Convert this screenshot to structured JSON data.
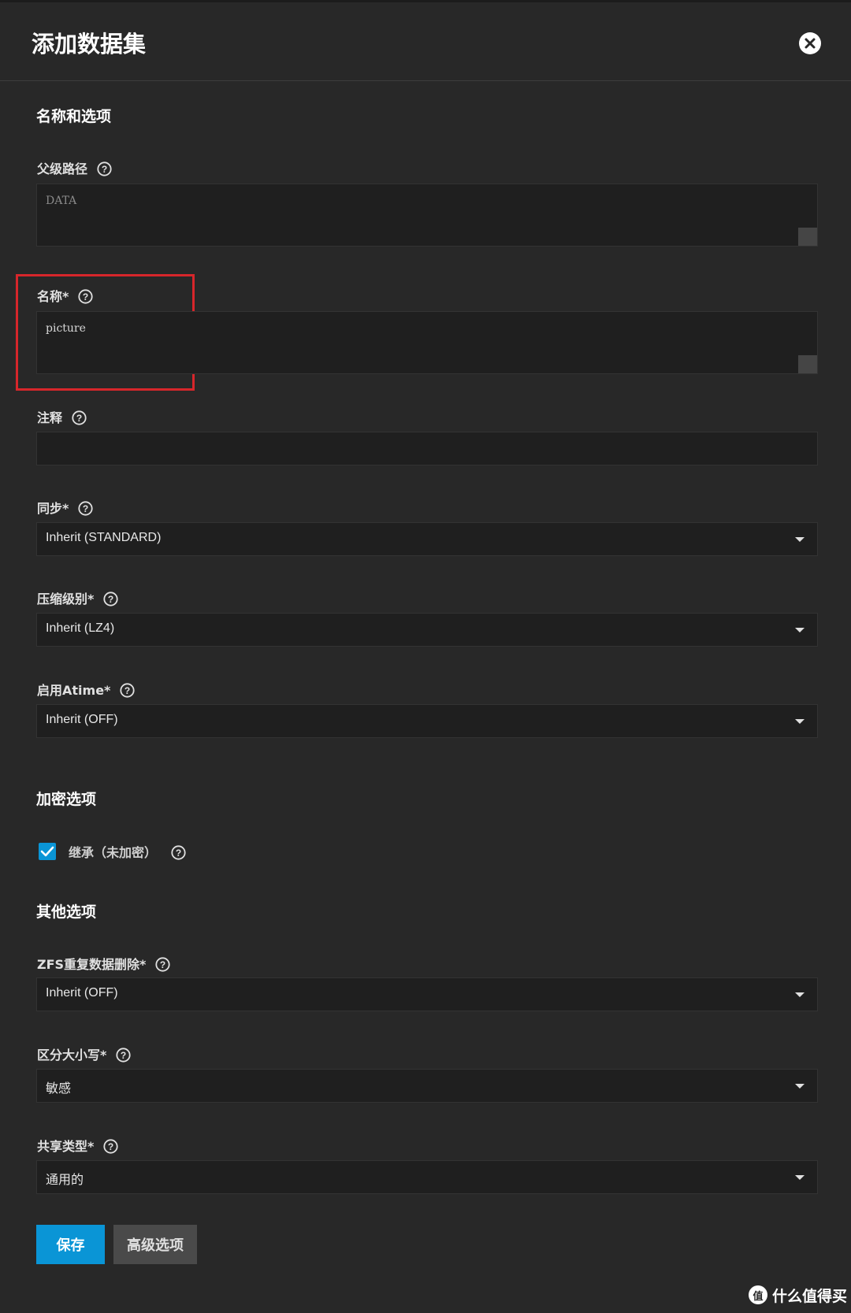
{
  "dialog": {
    "title": "添加数据集"
  },
  "sections": {
    "name_options": "名称和选项",
    "encryption": "加密选项",
    "other": "其他选项"
  },
  "fields": {
    "parent_path": {
      "label": "父级路径",
      "value": "DATA"
    },
    "name": {
      "label": "名称*",
      "value": "picture"
    },
    "comments": {
      "label": "注释",
      "value": ""
    },
    "sync": {
      "label": "同步*",
      "value": "Inherit (STANDARD)"
    },
    "compression": {
      "label": "压缩级别*",
      "value": "Inherit (LZ4)"
    },
    "atime": {
      "label": "启用Atime*",
      "value": "Inherit (OFF)"
    },
    "dedup": {
      "label": "ZFS重复数据删除*",
      "value": "Inherit (OFF)"
    },
    "case_sensitivity": {
      "label": "区分大小写*",
      "value": "敏感"
    },
    "share_type": {
      "label": "共享类型*",
      "value": "通用的"
    }
  },
  "encryption": {
    "inherit_label": "继承（未加密）",
    "checked": true
  },
  "buttons": {
    "save": "保存",
    "advanced": "高级选项"
  },
  "watermark": {
    "logo": "值",
    "text": "什么值得买"
  },
  "colors": {
    "background": "#282828",
    "field_bg": "#1f1f1f",
    "accent": "#0a95d6",
    "highlight": "#d7262b"
  }
}
